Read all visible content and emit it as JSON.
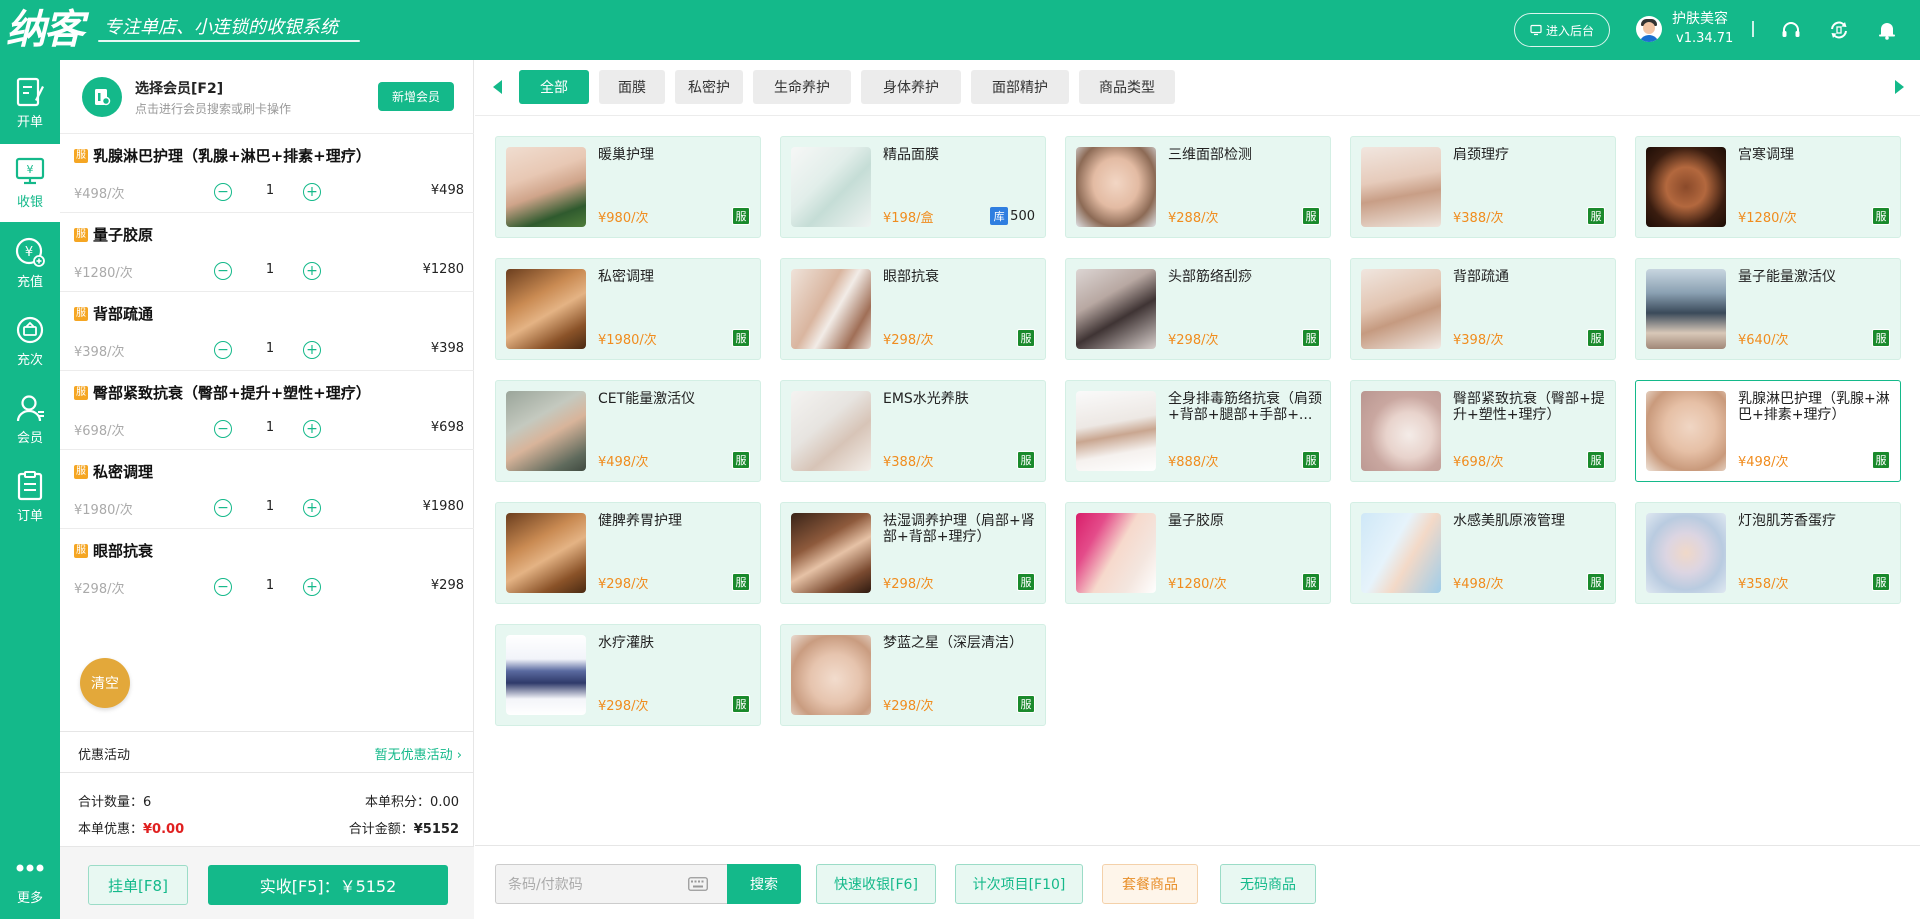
{
  "header": {
    "logo": "纳客",
    "slogan": "专注单店、小连锁的收银系统",
    "backend_button": "进入后台",
    "store_name": "护肤美容",
    "version": "v1.34.71"
  },
  "nav": {
    "items": [
      {
        "label": "开单",
        "icon": "edit-icon"
      },
      {
        "label": "收银",
        "icon": "cashier-icon"
      },
      {
        "label": "充值",
        "icon": "yen-add-icon"
      },
      {
        "label": "充次",
        "icon": "times-recharge-icon"
      },
      {
        "label": "会员",
        "icon": "member-icon"
      },
      {
        "label": "订单",
        "icon": "order-icon"
      },
      {
        "label": "更多",
        "icon": "more-icon"
      }
    ],
    "active": "收银"
  },
  "member": {
    "title": "选择会员[F2]",
    "hint": "点击进行会员搜索或刷卡操作",
    "new_button": "新增会员"
  },
  "order": {
    "badge": "服",
    "items": [
      {
        "name": "乳腺淋巴护理（乳腺+淋巴+排素+理疗）",
        "unit_price": "¥498/次",
        "qty": "1",
        "total": "¥498"
      },
      {
        "name": "量子胶原",
        "unit_price": "¥1280/次",
        "qty": "1",
        "total": "¥1280"
      },
      {
        "name": "背部疏通",
        "unit_price": "¥398/次",
        "qty": "1",
        "total": "¥398"
      },
      {
        "name": "臀部紧致抗衰（臀部+提升+塑性+理疗）",
        "unit_price": "¥698/次",
        "qty": "1",
        "total": "¥698"
      },
      {
        "name": "私密调理",
        "unit_price": "¥1980/次",
        "qty": "1",
        "total": "¥1980"
      },
      {
        "name": "眼部抗衰",
        "unit_price": "¥298/次",
        "qty": "1",
        "total": "¥298"
      }
    ],
    "clear_button": "清空",
    "promo_label": "优惠活动",
    "promo_value": "暂无优惠活动",
    "total_qty_label": "合计数量：",
    "total_qty": "6",
    "points_label": "本单积分：",
    "points": "0.00",
    "discount_label": "本单优惠：",
    "discount": "¥0.00",
    "amount_label": "合计金额：",
    "amount": "¥5152",
    "hold_button": "挂单[F8]",
    "pay_button": "实收[F5]：￥5152"
  },
  "categories": {
    "tabs": [
      "全部",
      "面膜",
      "私密护",
      "生命养护",
      "身体养护",
      "面部精护",
      "商品类型"
    ],
    "active": "全部"
  },
  "products": [
    {
      "name": "暖巢护理",
      "price": "¥980/次",
      "badge": "服"
    },
    {
      "name": "精品面膜",
      "price": "¥198/盒",
      "stock_label": "库",
      "stock": "500"
    },
    {
      "name": "三维面部检测",
      "price": "¥288/次",
      "badge": "服"
    },
    {
      "name": "肩颈理疗",
      "price": "¥388/次",
      "badge": "服"
    },
    {
      "name": "宫寒调理",
      "price": "¥1280/次",
      "badge": "服"
    },
    {
      "name": "私密调理",
      "price": "¥1980/次",
      "badge": "服"
    },
    {
      "name": "眼部抗衰",
      "price": "¥298/次",
      "badge": "服"
    },
    {
      "name": "头部筋络刮痧",
      "price": "¥298/次",
      "badge": "服"
    },
    {
      "name": "背部疏通",
      "price": "¥398/次",
      "badge": "服"
    },
    {
      "name": "量子能量激活仪",
      "price": "¥640/次",
      "badge": "服"
    },
    {
      "name": "CET能量激活仪",
      "price": "¥498/次",
      "badge": "服"
    },
    {
      "name": "EMS水光养肤",
      "price": "¥388/次",
      "badge": "服"
    },
    {
      "name": "全身排毒筋络抗衰（肩颈+背部+腿部+手部+...",
      "price": "¥888/次",
      "badge": "服"
    },
    {
      "name": "臀部紧致抗衰（臀部+提升+塑性+理疗）",
      "price": "¥698/次",
      "badge": "服"
    },
    {
      "name": "乳腺淋巴护理（乳腺+淋巴+排素+理疗）",
      "price": "¥498/次",
      "badge": "服"
    },
    {
      "name": "健脾养胃护理",
      "price": "¥298/次",
      "badge": "服"
    },
    {
      "name": "祛湿调养护理（肩部+肾部+背部+理疗）",
      "price": "¥298/次",
      "badge": "服"
    },
    {
      "name": "量子胶原",
      "price": "¥1280/次",
      "badge": "服"
    },
    {
      "name": "水感美肌原液管理",
      "price": "¥498/次",
      "badge": "服"
    },
    {
      "name": "灯泡肌芳香蛋疗",
      "price": "¥358/次",
      "badge": "服"
    },
    {
      "name": "水疗灌肤",
      "price": "¥298/次",
      "badge": "服"
    },
    {
      "name": "梦蓝之星（深层清洁）",
      "price": "¥298/次",
      "badge": "服"
    }
  ],
  "search": {
    "placeholder": "条码/付款码",
    "button": "搜索"
  },
  "actions": {
    "quick_pay": "快速收银[F6]",
    "count_item": "计次项目[F10]",
    "package": "套餐商品",
    "no_code": "无码商品"
  },
  "colors": {
    "brand": "#14b98a",
    "price": "#f08c1e",
    "service_badge": "#1a8a2c",
    "stock_badge": "#2f7ee0",
    "clear_button": "#e3a83a",
    "discount_red": "#e02020"
  }
}
